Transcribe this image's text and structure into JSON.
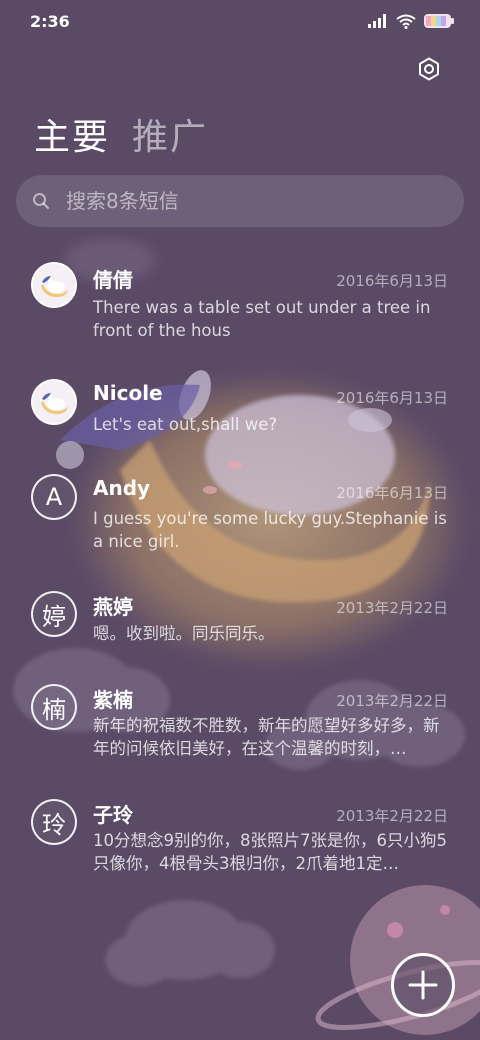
{
  "status_bar": {
    "time": "2:36",
    "icons": [
      "signal-icon",
      "wifi-icon",
      "battery-icon"
    ]
  },
  "header": {
    "settings_icon": "gear-icon",
    "tabs": [
      {
        "label": "主要",
        "active": true
      },
      {
        "label": "推广",
        "active": false
      }
    ]
  },
  "search": {
    "placeholder": "搜索8条短信"
  },
  "messages": [
    {
      "name": "倩倩",
      "date": "2016年6月13日",
      "avatar": "bunny-moon-avatar",
      "preview": "There was a table set out under a tree in front of the hous"
    },
    {
      "name": "Nicole",
      "date": "2016年6月13日",
      "avatar": "bunny-moon-avatar",
      "preview": "Let's eat out,shall we?"
    },
    {
      "name": "Andy",
      "date": "2016年6月13日",
      "avatar_letter": "A",
      "preview": "I guess you're some lucky guy.Stephanie is a nice girl."
    },
    {
      "name": "燕婷",
      "date": "2013年2月22日",
      "avatar_letter": "婷",
      "preview": "嗯。收到啦。同乐同乐。"
    },
    {
      "name": "紫楠",
      "date": "2013年2月22日",
      "avatar_letter": "楠",
      "preview": "新年的祝福数不胜数，新年的愿望好多好多，新年的问候依旧美好，在这个温馨的时刻，…"
    },
    {
      "name": "子玲",
      "date": "2013年2月22日",
      "avatar_letter": "玲",
      "preview": "10分想念9别的你，8张照片7张是你，6只小狗5只像你，4根骨头3根归你，2爪着地1定…"
    }
  ],
  "fab": {
    "icon": "plus-icon"
  },
  "colors": {
    "background": "#5a4a66",
    "text_primary": "#ffffff",
    "moon": "#f2c77a"
  }
}
